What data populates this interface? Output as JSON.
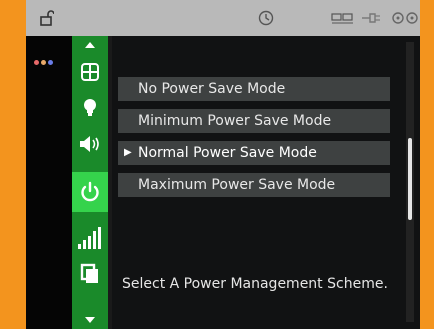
{
  "status_bar": {
    "icons": [
      "lock-open-icon",
      "clock-icon",
      "usb-icon",
      "plug-icon",
      "more-icon"
    ]
  },
  "sidebar": {
    "items": [
      {
        "icon": "scroll-up-arrow-icon",
        "active": false
      },
      {
        "icon": "grid-icon",
        "active": false
      },
      {
        "icon": "lightbulb-icon",
        "active": false
      },
      {
        "icon": "speaker-icon",
        "active": false
      },
      {
        "icon": "power-icon",
        "active": true
      },
      {
        "icon": "signal-bars-icon",
        "active": false
      },
      {
        "icon": "copy-icon",
        "active": false
      },
      {
        "icon": "scroll-down-arrow-icon",
        "active": false
      }
    ]
  },
  "power_menu": {
    "options": [
      {
        "label": "No Power Save Mode",
        "selected": false
      },
      {
        "label": "Minimum Power Save Mode",
        "selected": false
      },
      {
        "label": "Normal Power Save Mode",
        "selected": true
      },
      {
        "label": "Maximum Power Save Mode",
        "selected": false
      }
    ],
    "selected_marker": "▶",
    "description": "Select A Power Management Scheme."
  },
  "colors": {
    "bezel": "#f3941e",
    "sidebar": "#1a8a2a",
    "sidebar_active": "#35d34c",
    "menu_item_bg": "#3e4141",
    "text": "#e8e8e8"
  }
}
